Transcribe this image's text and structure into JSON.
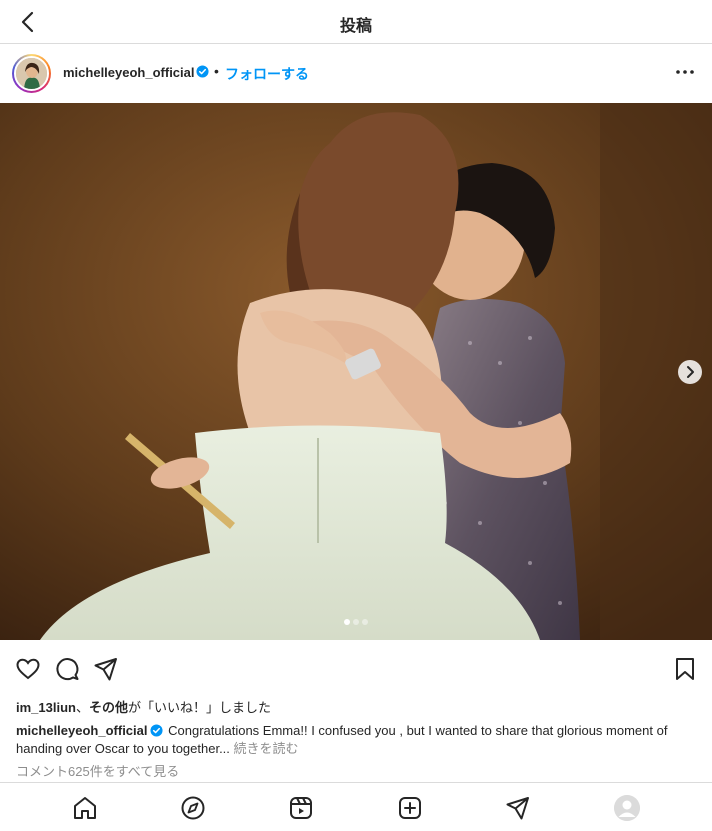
{
  "topbar": {
    "title": "投稿",
    "back_icon": "chevron-left-icon"
  },
  "post": {
    "username": "michelleyeoh_official",
    "verified": true,
    "separator": "•",
    "follow_label": "フォローする",
    "more_icon": "more-horizontal-icon",
    "image_alt": "Two women embracing on stage",
    "carousel": {
      "current": 1,
      "total": 3
    }
  },
  "actions": {
    "like_icon": "heart-icon",
    "comment_icon": "comment-icon",
    "share_icon": "send-icon",
    "save_icon": "bookmark-icon"
  },
  "likes": {
    "liker": "im_13liun",
    "joiner": "、",
    "others": "その他",
    "suffix": "が「いいね！」しました"
  },
  "caption": {
    "username": "michelleyeoh_official",
    "text": "Congratulations Emma!! I confused you , but I wanted to share that glorious moment of handing over Oscar to you together...",
    "more_label": "続きを読む"
  },
  "comments_link": "コメント625件をすべて見る",
  "bottom_nav": {
    "items": [
      "home-icon",
      "explore-icon",
      "reels-icon",
      "create-icon",
      "direct-icon",
      "profile-avatar"
    ]
  },
  "colors": {
    "accent": "#0095f6",
    "text": "#262626",
    "muted": "#8e8e8e",
    "border": "#dbdbdb"
  }
}
